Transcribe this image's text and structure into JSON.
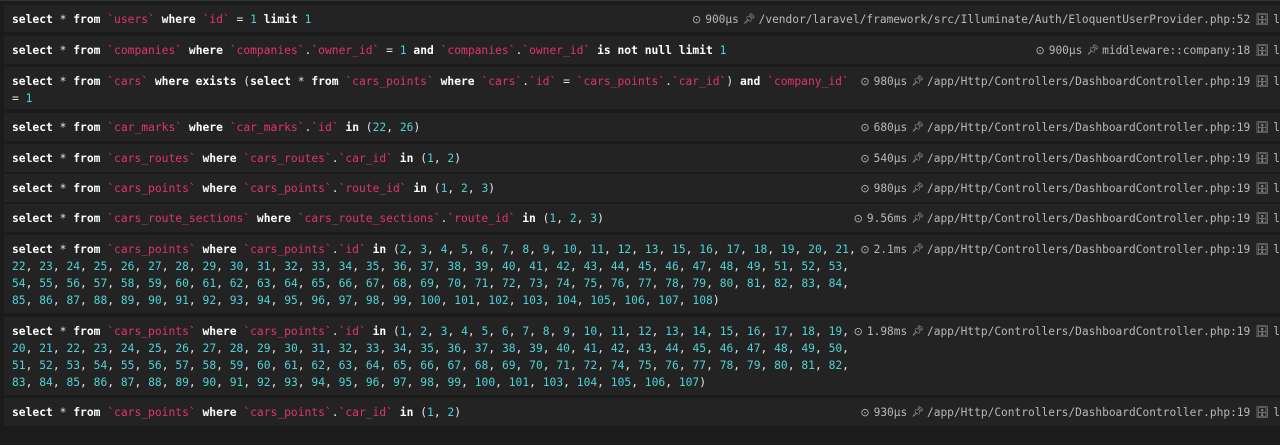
{
  "queries": [
    {
      "tokens": [
        [
          "k",
          "select"
        ],
        [
          "t",
          " * "
        ],
        [
          "k",
          "from"
        ],
        [
          "t",
          " "
        ],
        [
          "i",
          "`users`"
        ],
        [
          "t",
          " "
        ],
        [
          "k",
          "where"
        ],
        [
          "t",
          " "
        ],
        [
          "i",
          "`id`"
        ],
        [
          "t",
          " = "
        ],
        [
          "n",
          "1"
        ],
        [
          "t",
          " "
        ],
        [
          "k",
          "limit"
        ],
        [
          "t",
          " "
        ],
        [
          "n",
          "1"
        ]
      ],
      "duration": "900µs",
      "source": "/vendor/laravel/framework/src/Illuminate/Auth/EloquentUserProvider.php:52",
      "conn": "l"
    },
    {
      "tokens": [
        [
          "k",
          "select"
        ],
        [
          "t",
          " * "
        ],
        [
          "k",
          "from"
        ],
        [
          "t",
          " "
        ],
        [
          "i",
          "`companies`"
        ],
        [
          "t",
          " "
        ],
        [
          "k",
          "where"
        ],
        [
          "t",
          " "
        ],
        [
          "i",
          "`companies`"
        ],
        [
          "t",
          "."
        ],
        [
          "i",
          "`owner_id`"
        ],
        [
          "t",
          " = "
        ],
        [
          "n",
          "1"
        ],
        [
          "t",
          " "
        ],
        [
          "k",
          "and"
        ],
        [
          "t",
          " "
        ],
        [
          "i",
          "`companies`"
        ],
        [
          "t",
          "."
        ],
        [
          "i",
          "`owner_id`"
        ],
        [
          "t",
          " "
        ],
        [
          "k",
          "is not null"
        ],
        [
          "t",
          " "
        ],
        [
          "k",
          "limit"
        ],
        [
          "t",
          " "
        ],
        [
          "n",
          "1"
        ]
      ],
      "duration": "900µs",
      "source": "middleware::company:18",
      "conn": "l"
    },
    {
      "tokens": [
        [
          "k",
          "select"
        ],
        [
          "t",
          " * "
        ],
        [
          "k",
          "from"
        ],
        [
          "t",
          " "
        ],
        [
          "i",
          "`cars`"
        ],
        [
          "t",
          " "
        ],
        [
          "k",
          "where exists"
        ],
        [
          "t",
          " ("
        ],
        [
          "k",
          "select"
        ],
        [
          "t",
          " * "
        ],
        [
          "k",
          "from"
        ],
        [
          "t",
          " "
        ],
        [
          "i",
          "`cars_points`"
        ],
        [
          "t",
          " "
        ],
        [
          "k",
          "where"
        ],
        [
          "t",
          " "
        ],
        [
          "i",
          "`cars`"
        ],
        [
          "t",
          "."
        ],
        [
          "i",
          "`id`"
        ],
        [
          "t",
          " = "
        ],
        [
          "i",
          "`cars_points`"
        ],
        [
          "t",
          "."
        ],
        [
          "i",
          "`car_id`"
        ],
        [
          "t",
          ") "
        ],
        [
          "k",
          "and"
        ],
        [
          "t",
          " "
        ],
        [
          "i",
          "`company_id`"
        ],
        [
          "t",
          " = "
        ],
        [
          "n",
          "1"
        ]
      ],
      "duration": "980µs",
      "source": "/app/Http/Controllers/DashboardController.php:19",
      "conn": "l"
    },
    {
      "tokens": [
        [
          "k",
          "select"
        ],
        [
          "t",
          " * "
        ],
        [
          "k",
          "from"
        ],
        [
          "t",
          " "
        ],
        [
          "i",
          "`car_marks`"
        ],
        [
          "t",
          " "
        ],
        [
          "k",
          "where"
        ],
        [
          "t",
          " "
        ],
        [
          "i",
          "`car_marks`"
        ],
        [
          "t",
          "."
        ],
        [
          "i",
          "`id`"
        ],
        [
          "t",
          " "
        ],
        [
          "k",
          "in"
        ],
        [
          "t",
          " ("
        ],
        [
          "n",
          "22"
        ],
        [
          "t",
          ", "
        ],
        [
          "n",
          "26"
        ],
        [
          "t",
          ")"
        ]
      ],
      "duration": "680µs",
      "source": "/app/Http/Controllers/DashboardController.php:19",
      "conn": "l"
    },
    {
      "tokens": [
        [
          "k",
          "select"
        ],
        [
          "t",
          " * "
        ],
        [
          "k",
          "from"
        ],
        [
          "t",
          " "
        ],
        [
          "i",
          "`cars_routes`"
        ],
        [
          "t",
          " "
        ],
        [
          "k",
          "where"
        ],
        [
          "t",
          " "
        ],
        [
          "i",
          "`cars_routes`"
        ],
        [
          "t",
          "."
        ],
        [
          "i",
          "`car_id`"
        ],
        [
          "t",
          " "
        ],
        [
          "k",
          "in"
        ],
        [
          "t",
          " ("
        ],
        [
          "n",
          "1"
        ],
        [
          "t",
          ", "
        ],
        [
          "n",
          "2"
        ],
        [
          "t",
          ")"
        ]
      ],
      "duration": "540µs",
      "source": "/app/Http/Controllers/DashboardController.php:19",
      "conn": "l"
    },
    {
      "tokens": [
        [
          "k",
          "select"
        ],
        [
          "t",
          " * "
        ],
        [
          "k",
          "from"
        ],
        [
          "t",
          " "
        ],
        [
          "i",
          "`cars_points`"
        ],
        [
          "t",
          " "
        ],
        [
          "k",
          "where"
        ],
        [
          "t",
          " "
        ],
        [
          "i",
          "`cars_points`"
        ],
        [
          "t",
          "."
        ],
        [
          "i",
          "`route_id`"
        ],
        [
          "t",
          " "
        ],
        [
          "k",
          "in"
        ],
        [
          "t",
          " ("
        ],
        [
          "n",
          "1"
        ],
        [
          "t",
          ", "
        ],
        [
          "n",
          "2"
        ],
        [
          "t",
          ", "
        ],
        [
          "n",
          "3"
        ],
        [
          "t",
          ")"
        ]
      ],
      "duration": "980µs",
      "source": "/app/Http/Controllers/DashboardController.php:19",
      "conn": "l"
    },
    {
      "tokens": [
        [
          "k",
          "select"
        ],
        [
          "t",
          " * "
        ],
        [
          "k",
          "from"
        ],
        [
          "t",
          " "
        ],
        [
          "i",
          "`cars_route_sections`"
        ],
        [
          "t",
          " "
        ],
        [
          "k",
          "where"
        ],
        [
          "t",
          " "
        ],
        [
          "i",
          "`cars_route_sections`"
        ],
        [
          "t",
          "."
        ],
        [
          "i",
          "`route_id`"
        ],
        [
          "t",
          " "
        ],
        [
          "k",
          "in"
        ],
        [
          "t",
          " ("
        ],
        [
          "n",
          "1"
        ],
        [
          "t",
          ", "
        ],
        [
          "n",
          "2"
        ],
        [
          "t",
          ", "
        ],
        [
          "n",
          "3"
        ],
        [
          "t",
          ")"
        ]
      ],
      "duration": "9.56ms",
      "source": "/app/Http/Controllers/DashboardController.php:19",
      "conn": "l"
    },
    {
      "tokens": [
        [
          "k",
          "select"
        ],
        [
          "t",
          " * "
        ],
        [
          "k",
          "from"
        ],
        [
          "t",
          " "
        ],
        [
          "i",
          "`cars_points`"
        ],
        [
          "t",
          " "
        ],
        [
          "k",
          "where"
        ],
        [
          "t",
          " "
        ],
        [
          "i",
          "`cars_points`"
        ],
        [
          "t",
          "."
        ],
        [
          "i",
          "`id`"
        ],
        [
          "t",
          " "
        ],
        [
          "k",
          "in"
        ],
        [
          "t",
          " ("
        ],
        [
          "L",
          "2, 3, 4, 5, 6, 7, 8, 9, 10, 11, 12, 13, 15, 16, 17, 18, 19, 20, 21, 22, 23, 24, 25, 26, 27, 28, 29, 30, 31, 32, 33, 34, 35, 36, 37, 38, 39, 40, 41, 42, 43, 44, 45, 46, 47, 48, 49, 51, 52, 53, 54, 55, 56, 57, 58, 59, 60, 61, 62, 63, 64, 65, 66, 67, 68, 69, 70, 71, 72, 73, 74, 75, 76, 77, 78, 79, 80, 81, 82, 83, 84, 85, 86, 87, 88, 89, 90, 91, 92, 93, 94, 95, 96, 97, 98, 99, 100, 101, 102, 103, 104, 105, 106, 107, 108"
        ],
        [
          "t",
          ")"
        ]
      ],
      "duration": "2.1ms",
      "source": "/app/Http/Controllers/DashboardController.php:19",
      "conn": "l"
    },
    {
      "tokens": [
        [
          "k",
          "select"
        ],
        [
          "t",
          " * "
        ],
        [
          "k",
          "from"
        ],
        [
          "t",
          " "
        ],
        [
          "i",
          "`cars_points`"
        ],
        [
          "t",
          " "
        ],
        [
          "k",
          "where"
        ],
        [
          "t",
          " "
        ],
        [
          "i",
          "`cars_points`"
        ],
        [
          "t",
          "."
        ],
        [
          "i",
          "`id`"
        ],
        [
          "t",
          " "
        ],
        [
          "k",
          "in"
        ],
        [
          "t",
          " ("
        ],
        [
          "L",
          "1, 2, 3, 4, 5, 6, 7, 8, 9, 10, 11, 12, 13, 14, 15, 16, 17, 18, 19, 20, 21, 22, 23, 24, 25, 26, 27, 28, 29, 30, 31, 32, 33, 34, 35, 36, 37, 38, 39, 40, 41, 42, 43, 44, 45, 46, 47, 48, 49, 50, 51, 52, 53, 54, 55, 56, 57, 58, 59, 60, 61, 62, 63, 64, 65, 66, 67, 68, 69, 70, 71, 72, 74, 75, 76, 77, 78, 79, 80, 81, 82, 83, 84, 85, 86, 87, 88, 89, 90, 91, 92, 93, 94, 95, 96, 97, 98, 99, 100, 101, 103, 104, 105, 106, 107"
        ],
        [
          "t",
          ")"
        ]
      ],
      "duration": "1.98ms",
      "source": "/app/Http/Controllers/DashboardController.php:19",
      "conn": "l"
    },
    {
      "tokens": [
        [
          "k",
          "select"
        ],
        [
          "t",
          " * "
        ],
        [
          "k",
          "from"
        ],
        [
          "t",
          " "
        ],
        [
          "i",
          "`cars_points`"
        ],
        [
          "t",
          " "
        ],
        [
          "k",
          "where"
        ],
        [
          "t",
          " "
        ],
        [
          "i",
          "`cars_points`"
        ],
        [
          "t",
          "."
        ],
        [
          "i",
          "`car_id`"
        ],
        [
          "t",
          " "
        ],
        [
          "k",
          "in"
        ],
        [
          "t",
          " ("
        ],
        [
          "n",
          "1"
        ],
        [
          "t",
          ", "
        ],
        [
          "n",
          "2"
        ],
        [
          "t",
          ")"
        ]
      ],
      "duration": "930µs",
      "source": "/app/Http/Controllers/DashboardController.php:19",
      "conn": "l"
    }
  ],
  "icons": {
    "clock": "clock-icon",
    "pin": "pin-icon",
    "database": "database-icon"
  },
  "colors": {
    "background": "#1b1b1c",
    "row": "#232324",
    "identifier": "#e0336e",
    "number": "#4fd3d3",
    "keyword": "#ffffff"
  }
}
